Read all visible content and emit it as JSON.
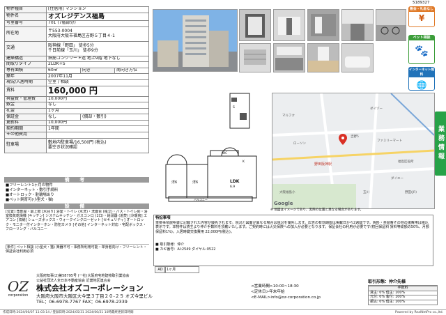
{
  "doc_id": "5189327",
  "property": {
    "type_label": "物件種目",
    "type_value": "[住居用] マンション",
    "name_label": "物件名",
    "name_value": "オズレジデンス福島",
    "room_label": "号室番号",
    "room_value": "701 (7階部分)",
    "address_label": "所在地",
    "address_value": "〒553-0004\n大阪府大阪市福島区吉野５丁目４-1",
    "transport_label": "交通",
    "transport_value": "阪神線「野田」 徒歩5分\n千日前線「玉川」 徒歩9分",
    "structure_label": "建築構造",
    "structure_value": "鉄筋コンクリート造 地上9階 地下なし",
    "layout_label": "間取りタイプ",
    "layout_value": "2LDK+S",
    "area_label": "専有面積",
    "area_value": "60㎡",
    "direction_label": "向き",
    "direction_value": "南向き方位",
    "built_label": "築年",
    "built_value": "2007年11月",
    "status_label": "現況/入居時期",
    "status_value": "空室 / 相談",
    "rent_label": "賃料",
    "rent_value": "160,000 円",
    "mgmt_label": "共益費・管理費",
    "mgmt_value": "10,000円",
    "deposit_label": "敷金",
    "deposit_value": "なし",
    "keymoney_label": "礼金",
    "keymoney_value": "1ヶ月",
    "guarantee_label": "保証金",
    "guarantee_value": "なし",
    "guarantee_note": "(償却・敷引)",
    "renewal_label": "更新料",
    "renewal_value": "10,000円",
    "contract_label": "契約期間",
    "contract_value": "1年間",
    "other_fee_label": "その他費用",
    "other_fee_value": "",
    "parking_label": "駐車場",
    "parking_value1": "敷地内駐車場/16,500円 (税込)",
    "parking_value2": "要空き状況確認"
  },
  "remarks": {
    "title": "備 考",
    "items": [
      "■フリーレント1ヶ月の物件",
      "■インターネット・敷引手続料",
      "■オートロック・駐輪場あり",
      "■ペット飼育可(小型犬・猫)"
    ]
  },
  "equipment": {
    "title": "設 備",
    "text": "[位置] 角部屋・最上階 [水回り] 浴室・トイレ (水洗)・洗面台 (独立)・バス・トイレ別・浴室換気乾燥機 [キッチン] システムキッチン・ガスコンロ (2口)・給湯器 (追焚) [冷暖房] エアコン [収納] シューズボックス・ウォークインクローゼット [セキュリティ] オートロック・モニター付インターホン・防犯カメラ [その他] インターネット対応・宅配ボックス・フローリング・バルコニー",
    "notes_label": "[条件]",
    "notes": "[条件] ペット相談 (小型犬・猫) 楽器不可・事務所利用可能・単身者向け・フリーレント・保証会社利用必須"
  },
  "badges": {
    "badge1": "敷金・礼金なし",
    "badge2": "ペット相談",
    "badge3": "インターネット無料"
  },
  "side_tab": "業務情報",
  "floorplan_labels": {
    "room1": "洋6",
    "room2": "洋6",
    "ldk": "LDK",
    "room1b": "6.9",
    "kitchen": "K",
    "balcony": "バルコニー",
    "storage": "S",
    "walkin": "WIC"
  },
  "map": {
    "google": "Google",
    "caption": "※ 地図はイメージであり、実際の位置と異なる場合があります。",
    "labels": [
      "マルフク",
      "ダイゾー",
      "ローソン",
      "ファミリーマート",
      "吉野5",
      "野田阪神駅",
      "福島区役所",
      "大阪福島小",
      "ダイエー",
      "玉川",
      "野田(JR)"
    ]
  },
  "notes_block": {
    "title": "特記事項",
    "text": "重要事項説明書に記載された内容が優先されます。現況と図面が異なる場合は現況を優先します。広告の有効期限は掲載日から2週間です。賃料・共益費その他の諸費用は税込表示です。本物件は貸主より仲介手数料を頂戴いたします。ご契約時には火災保険への加入が必要となります。保証会社の利用が必要です(初回保証料 賃料等総額の50%、月額保証料1%)。入居時鍵交換費用 22,000円(税込)。",
    "items": [
      "■ 取引態様：仲介",
      "■ カギ番号：AI:2549 ダイヤル:0522"
    ],
    "ad_label": "AD",
    "ad_value": "1ヶ月"
  },
  "company": {
    "license1": "大阪府知事(2)第58795号 (一社)大阪府宅地建物取引業協会",
    "license2": "公益社団法人全日本不動産協会 近畿地区連合会",
    "logo_text": "OZ",
    "logo_sub": "corporation",
    "name": "株式会社オズコーポレーション",
    "address": "大阪府大阪市大阪区大今里３丁目２０-２５ オズ今里ビル",
    "tel_fax": "TEL：06-6978-7767 FAX：06-6978-2339",
    "hours": "<営業時間>10:00~18:30",
    "holiday": "<定休日>年末年始",
    "email": "<E-MAIL>info@oz-corporation.co.jp"
  },
  "commission": {
    "title": "取引形態：仲介先様",
    "sub": "手数料",
    "row1": "貸主: 0% 借主: 100%",
    "row2": "元付: 0% 客付: 100%",
    "row3": "振込: 0% 借主: 100%"
  },
  "footer_left": "作成日時:2024/06/07 11:03:14 / 登録日時:2024/05/31 2024/06/21 10時最終更新日時間",
  "footer_right": "Powered by RealNetPro co.,ltd."
}
